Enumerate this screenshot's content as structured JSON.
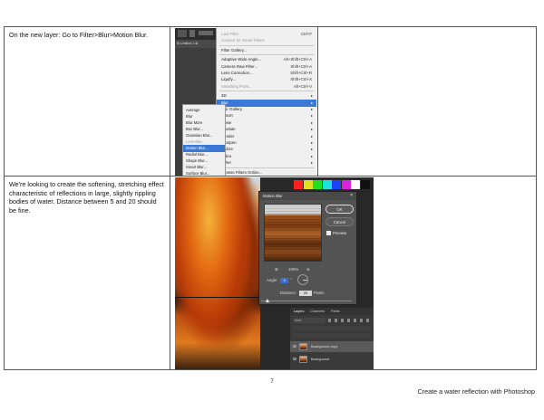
{
  "steps": [
    {
      "text": "On the new layer:  Go to Filter>Blur>Motion Blur."
    },
    {
      "text": "We're looking to create the softening, stretching effect characteristic of reflections in large, slightly rippling bodies of water. Distance between 5 and 20 should be fine."
    }
  ],
  "filter_menu": {
    "toolbar_tab": "⊞ Untitled-1 ⊠",
    "items": [
      {
        "label": "Last Filter",
        "shortcut": "Ctrl+F",
        "dim": true
      },
      {
        "label": "Convert for Smart Filters",
        "dim": true
      },
      {
        "label": "Filter Gallery..."
      },
      {
        "label": "Adaptive Wide Angle...",
        "shortcut": "Alt+Shift+Ctrl+A"
      },
      {
        "label": "Camera Raw Filter...",
        "shortcut": "Shift+Ctrl+A"
      },
      {
        "label": "Lens Correction...",
        "shortcut": "Shift+Ctrl+R"
      },
      {
        "label": "Liquify...",
        "shortcut": "Shift+Ctrl+X"
      },
      {
        "label": "Vanishing Point...",
        "shortcut": "Alt+Ctrl+V",
        "dim": true
      },
      {
        "label": "3D"
      },
      {
        "label": "Blur",
        "highlight": true
      },
      {
        "label": "Blur Gallery"
      },
      {
        "label": "Distort"
      },
      {
        "label": "Noise"
      },
      {
        "label": "Pixelate"
      },
      {
        "label": "Render"
      },
      {
        "label": "Sharpen"
      },
      {
        "label": "Stylize"
      },
      {
        "label": "Video"
      },
      {
        "label": "Other"
      },
      {
        "label": "Browse Filters Online..."
      }
    ],
    "blur_submenu": [
      {
        "label": "Average"
      },
      {
        "label": "Blur"
      },
      {
        "label": "Blur More"
      },
      {
        "label": "Box Blur..."
      },
      {
        "label": "Gaussian Blur..."
      },
      {
        "label": "Lens Blur...",
        "dim": true
      },
      {
        "label": "Motion Blur...",
        "highlight": true
      },
      {
        "label": "Radial Blur..."
      },
      {
        "label": "Shape Blur..."
      },
      {
        "label": "Smart Blur..."
      },
      {
        "label": "Surface Blur..."
      }
    ]
  },
  "motion_blur_dialog": {
    "title": "Motion Blur",
    "close_icon": "×",
    "ok_label": "OK",
    "cancel_label": "Cancel",
    "preview_label": "Preview",
    "zoom_in_icon": "⊕",
    "zoom_percent": "100%",
    "zoom_out_icon": "⊖",
    "angle_label": "Angle:",
    "angle_value": "0",
    "angle_unit": "°",
    "distance_label": "Distance:",
    "distance_value": "20",
    "distance_unit": "Pixels"
  },
  "swatch_colors": [
    "#ff2020",
    "#e0e020",
    "#20e020",
    "#20e0e0",
    "#2040ff",
    "#e020e0",
    "#ffffff",
    "#111111"
  ],
  "layers_panel": {
    "tabs": [
      "Layers",
      "Channels",
      "Paths"
    ],
    "kind_label": "Kind",
    "rows": [
      {
        "name": "Background copy",
        "selected": true
      },
      {
        "name": "Background"
      }
    ]
  },
  "page_number": "7",
  "footer": "Create a water reflection with Photoshop"
}
